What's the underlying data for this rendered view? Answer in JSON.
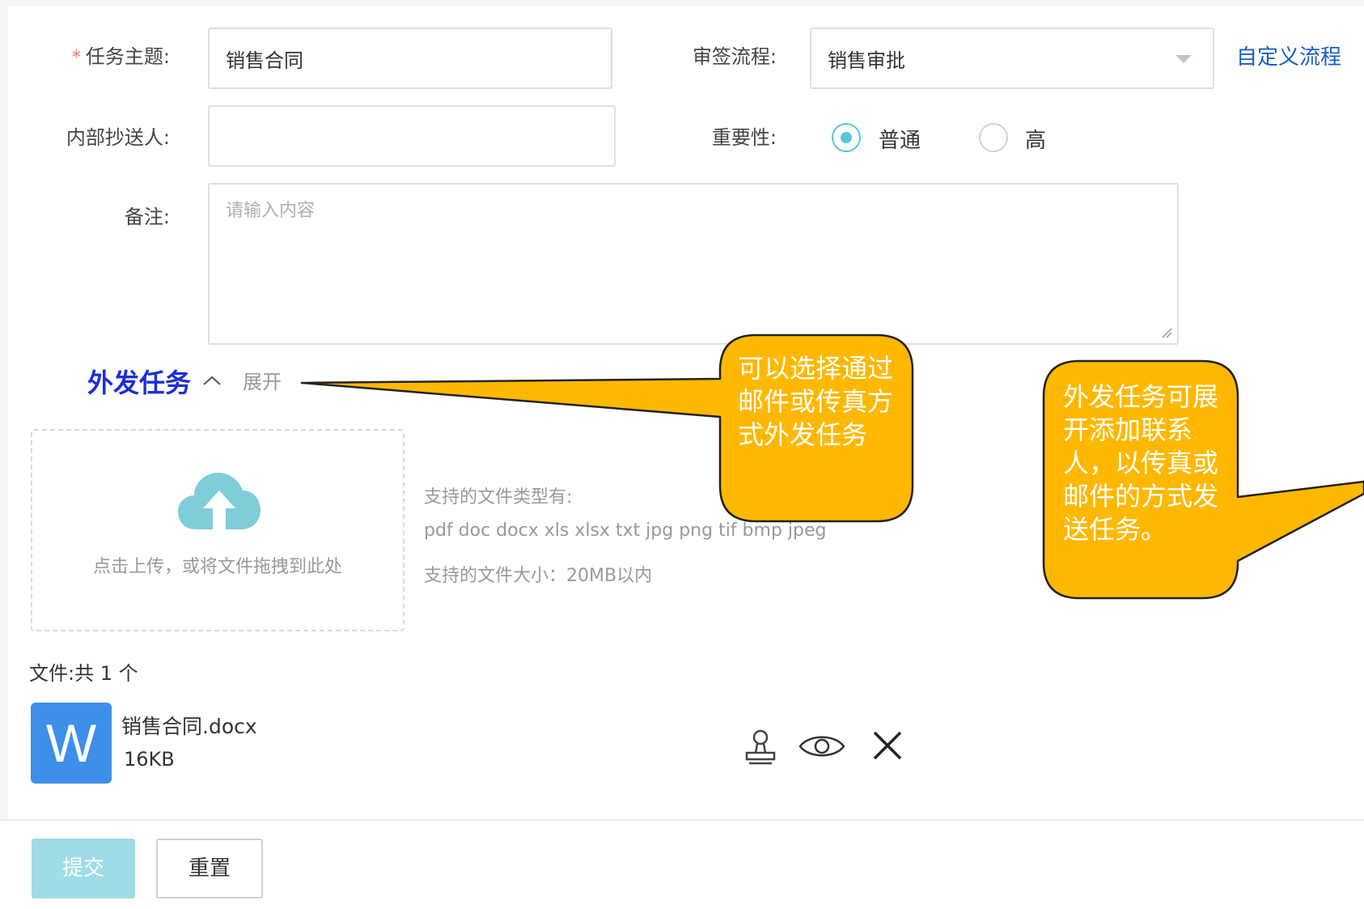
{
  "form": {
    "task_subject": {
      "required_mark": "*",
      "label": "任务主题:",
      "value": "销售合同"
    },
    "approval_flow": {
      "label": "审签流程:",
      "value": "销售审批",
      "custom_link": "自定义流程"
    },
    "internal_cc": {
      "label": "内部抄送人:",
      "value": ""
    },
    "importance": {
      "label": "重要性:",
      "options": [
        "普通",
        "高"
      ],
      "selected": "普通"
    },
    "remarks": {
      "label": "备注:",
      "placeholder": "请输入内容"
    }
  },
  "outbound": {
    "title": "外发任务",
    "toggle_label": "展开"
  },
  "upload": {
    "hint": "点击上传，或将文件拖拽到此处",
    "types_title": "支持的文件类型有:",
    "types": "pdf doc docx xls xlsx txt jpg png tif bmp jpeg",
    "size_limit": "支持的文件大小：20MB以内"
  },
  "files": {
    "count_label": "文件:共 1 个",
    "items": [
      {
        "icon_letter": "W",
        "name": "销售合同.docx",
        "size": "16KB"
      }
    ]
  },
  "file_actions": [
    "stamp-icon",
    "eye-icon",
    "close-icon"
  ],
  "buttons": {
    "submit": "提交",
    "reset": "重置"
  },
  "callouts": [
    {
      "text": "可以选择通过邮件或传真方式外发任务"
    },
    {
      "text": "外发任务可展开添加联系人，以传真或邮件的方式发送任务。"
    }
  ],
  "colors": {
    "primary": "#57c7d4",
    "link": "#1a5cc8",
    "section_title": "#1b2fd6",
    "word_icon": "#3d8fe8",
    "callout_fill": "#ffb800",
    "required": "#f56c6c"
  }
}
